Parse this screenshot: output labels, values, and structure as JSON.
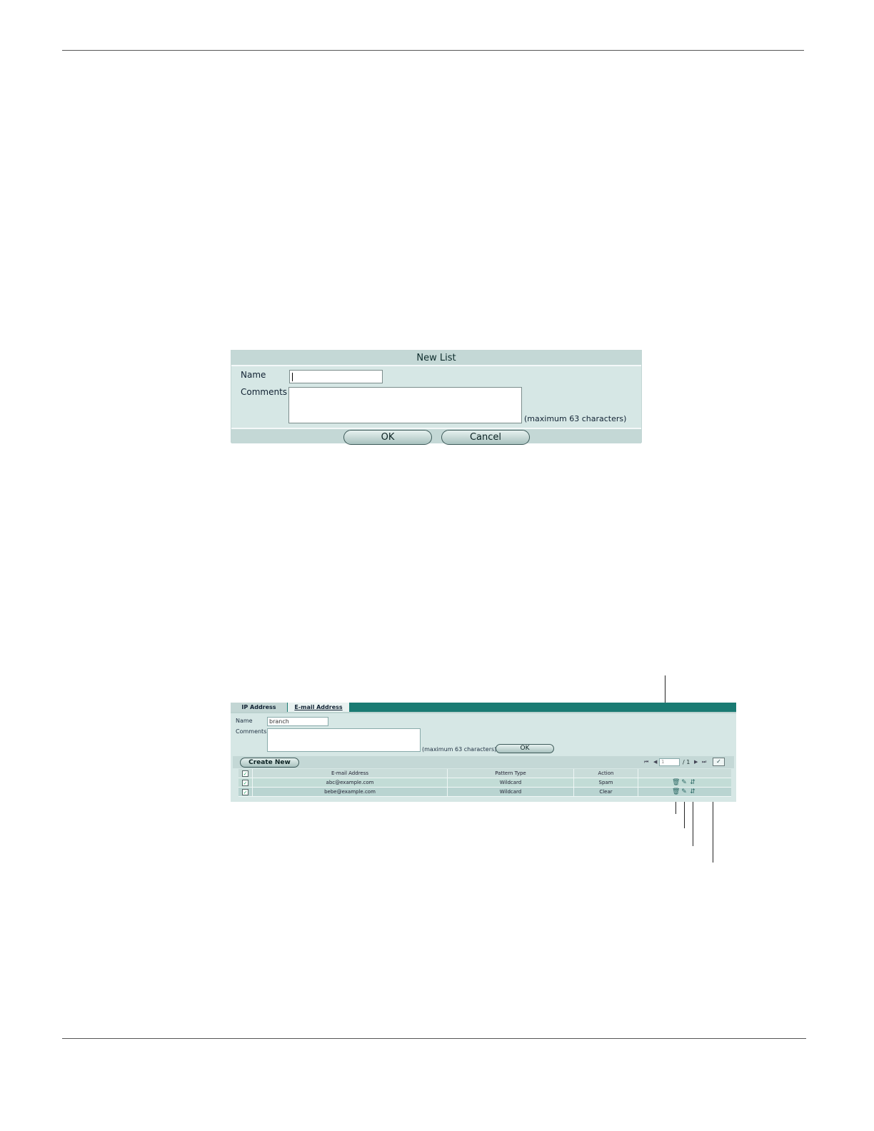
{
  "new_list_dialog": {
    "title": "New List",
    "name_label": "Name",
    "name_value": "",
    "comments_label": "Comments",
    "max_note": "(maximum 63 characters)",
    "ok_label": "OK",
    "cancel_label": "Cancel"
  },
  "list_panel": {
    "tabs": [
      "IP Address",
      "E-mail Address"
    ],
    "active_tab": "E-mail Address",
    "name_label": "Name",
    "name_value": "branch",
    "comments_label": "Comments",
    "max_note": "(maximum 63 characters)",
    "ok_label": "OK",
    "create_new_label": "Create New",
    "pagination": {
      "current_page": "1",
      "of_text": "/ 1"
    },
    "table": {
      "headers": [
        "E-mail Address",
        "Pattern Type",
        "Action"
      ],
      "rows": [
        {
          "email": "abc@example.com",
          "pattern_type": "Wildcard",
          "action": "Spam"
        },
        {
          "email": "bebe@example.com",
          "pattern_type": "Wildcard",
          "action": "Clear"
        }
      ]
    },
    "row_icons": [
      "delete-icon",
      "edit-icon",
      "move-icon"
    ],
    "toolbar_icons": [
      "first-page-icon",
      "previous-page-icon",
      "next-page-icon",
      "last-page-icon",
      "column-settings-icon"
    ]
  }
}
